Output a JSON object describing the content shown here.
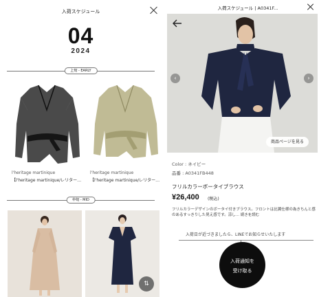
{
  "left": {
    "title": "入荷スケジュール",
    "month": "04",
    "year": "2024",
    "section_early": "上旬 - EARLY",
    "section_mid": "中旬 - MID",
    "products": [
      {
        "brand": "l'heritage martinique",
        "name": "【l'heritage martinique/レリタージュマルティニーク】"
      },
      {
        "brand": "l'heritage martinique",
        "name": "【l'heritage martinique/レリタージュマルティニーク】"
      }
    ],
    "sort_icon_glyph": "⇅"
  },
  "right": {
    "title": "入荷スケジュール | A0341F...",
    "detail_button": "商品ページを見る",
    "color": "Color : ネイビー",
    "sku": "品番 : A0341FB448",
    "name": "フリルカラーボータイブラウス",
    "price": "¥26,400",
    "tax": "(税込)",
    "description": "フリルカラーデザインのボータイ付きブラウス。フロントは比翼仕様の為きちんと感のあるすっきりした見え感です。涼し... 続きを読む",
    "notice": "入荷日が近づきましたら、LINEでお知らせいたします",
    "cta_line1": "入荷通知を",
    "cta_line2": "受け取る",
    "prev_glyph": "‹",
    "next_glyph": "›"
  },
  "colors": {
    "cta_bg": "#0d0d0d",
    "blouse_black": "#2a2a2a",
    "blouse_khaki": "#b9b48a",
    "navy": "#1f2640",
    "beige": "#d9bda3"
  }
}
